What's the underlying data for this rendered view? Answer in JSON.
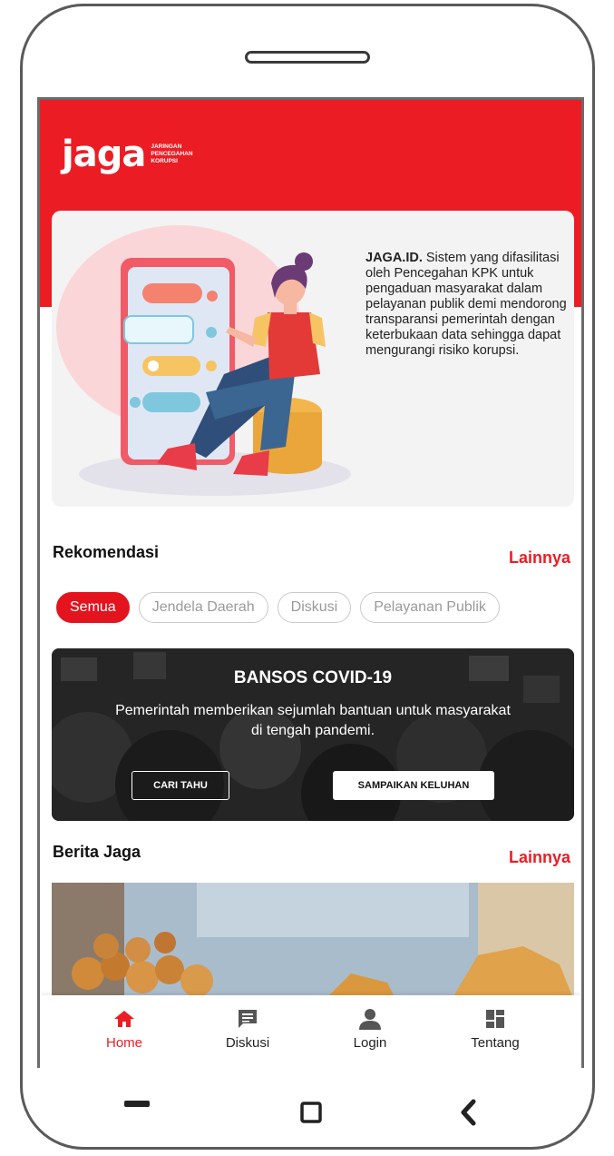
{
  "app": {
    "logo_text": "jaga",
    "logo_subtitle_lines": [
      "JARINGAN",
      "PENCEGAHAN",
      "KORUPSI"
    ]
  },
  "hero": {
    "title_bold": "JAGA.ID.",
    "description": " Sistem yang difasilitasi oleh Pencegahan KPK untuk pengaduan masyarakat dalam pelayanan publik demi mendorong transparansi pemerintah dengan keterbukaan data sehingga dapat mengurangi risiko korupsi."
  },
  "rekomendasi": {
    "title": "Rekomendasi",
    "more_label": "Lainnya",
    "chips": [
      {
        "label": "Semua",
        "active": true
      },
      {
        "label": "Jendela Daerah",
        "active": false
      },
      {
        "label": "Diskusi",
        "active": false
      },
      {
        "label": "Pelayanan Publik",
        "active": false
      }
    ]
  },
  "banner": {
    "title": "BANSOS COVID-19",
    "description_line1": "Pemerintah memberikan sejumlah bantuan untuk masyarakat",
    "description_line2": "di tengah pandemi.",
    "button_primary": "CARI TAHU",
    "button_secondary": "SAMPAIKAN KELUHAN"
  },
  "berita": {
    "title": "Berita Jaga",
    "more_label": "Lainnya"
  },
  "bottom_nav": {
    "items": [
      {
        "label": "Home",
        "icon": "home-icon",
        "active": true
      },
      {
        "label": "Diskusi",
        "icon": "chat-icon",
        "active": false
      },
      {
        "label": "Login",
        "icon": "person-icon",
        "active": false
      },
      {
        "label": "Tentang",
        "icon": "dashboard-icon",
        "active": false
      }
    ]
  },
  "colors": {
    "brand_red": "#ec1c24",
    "chip_inactive_text": "#9a9a9a",
    "nav_text": "#222222"
  }
}
